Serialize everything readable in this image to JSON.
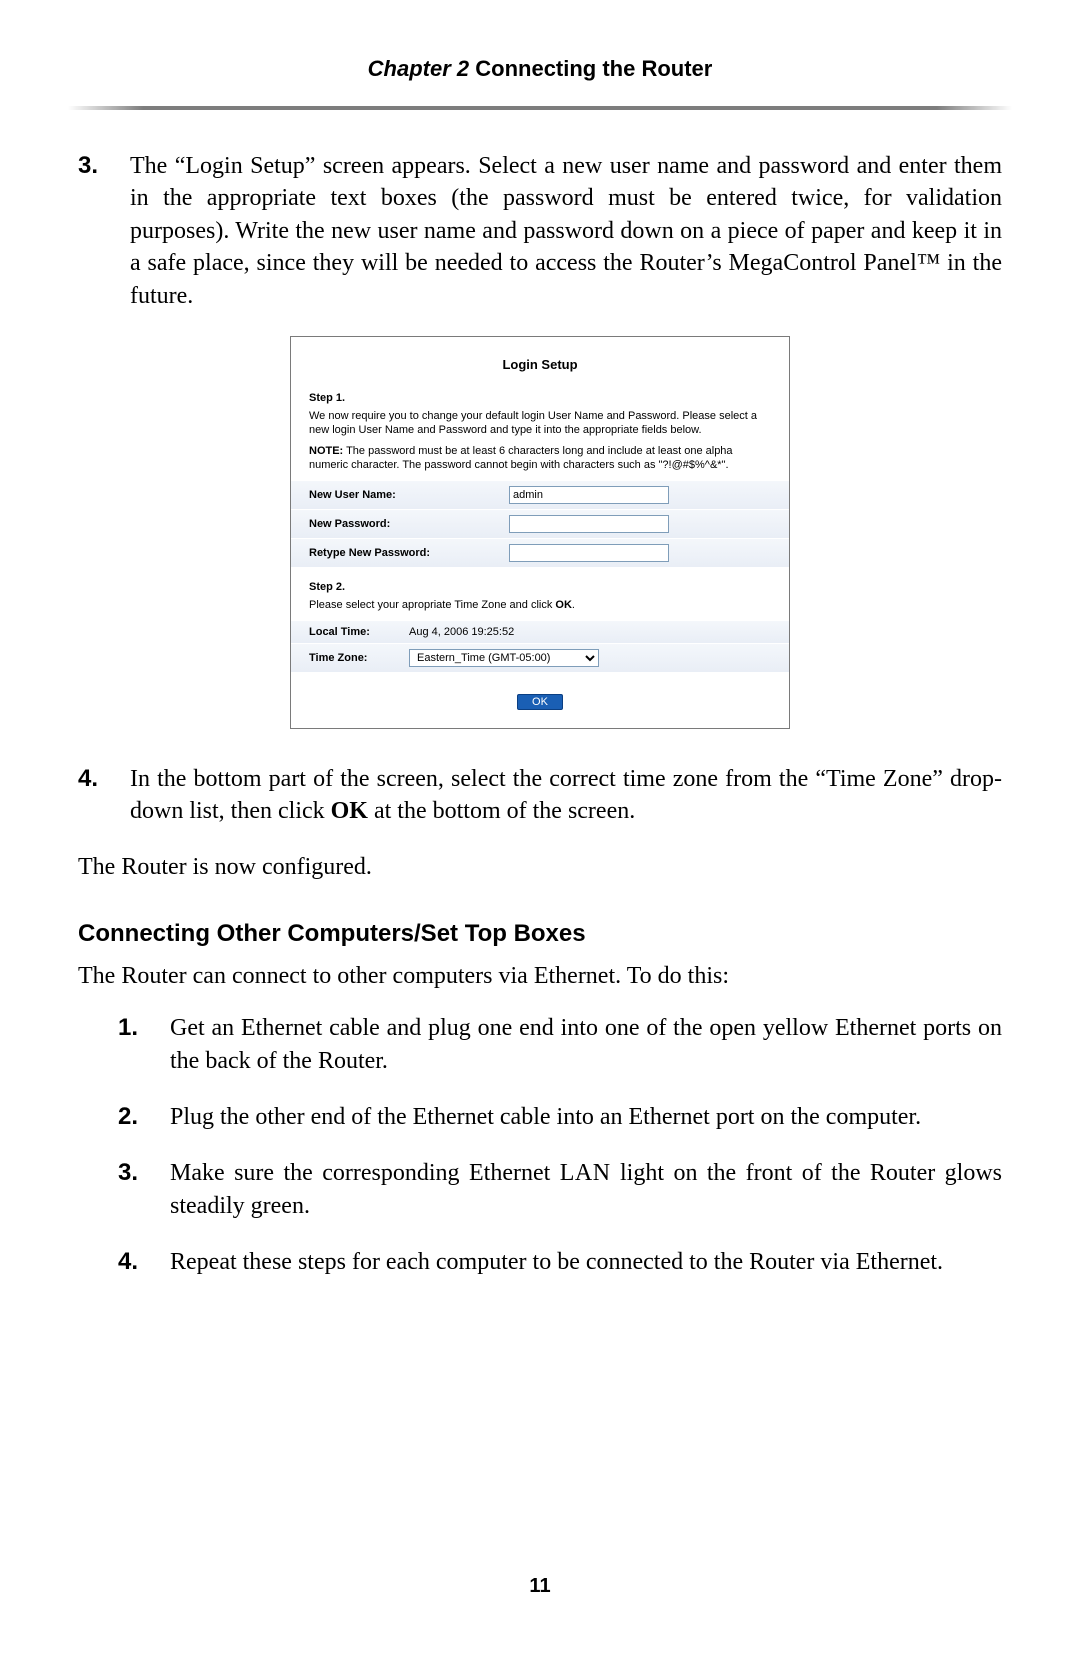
{
  "header": {
    "chapter_label": "Chapter 2",
    "chapter_title": "Connecting the Router"
  },
  "main": {
    "step3": {
      "num": "3.",
      "text_parts": {
        "a": "The “Login Setup” screen appears. Select a new user name and password and enter them in the appropriate text boxes (the password must be entered twice, for validation purposes). Write the new user name and password down on a piece of paper and keep it in a safe place, since they will be needed to access the Router’s MegaControl Panel™ in the future."
      }
    },
    "step4": {
      "num": "4.",
      "pre": "In the bottom part of the screen, select the correct time zone from the “Time Zone” drop-down list, then click ",
      "ok": "OK",
      "post": " at the bottom of the screen."
    },
    "config_done": "The Router is now configured.",
    "section_title": "Connecting Other Computers/Set Top Boxes",
    "section_intro": "The Router can connect to other computers via Ethernet. To do this:",
    "steps_b": [
      {
        "num": "1.",
        "text": "Get an Ethernet cable and plug one end into one of the open yellow Ethernet ports on the back of the Router."
      },
      {
        "num": "2.",
        "text": "Plug the other end of the Ethernet cable into an Ethernet port on the computer."
      },
      {
        "num": "3.",
        "pre": "Make sure the corresponding Ethernet ",
        "lan": "LAN",
        "post": " light on the front of the Router glows steadily green."
      },
      {
        "num": "4.",
        "text": "Repeat these steps for each computer to be connected to the Router via Ethernet."
      }
    ]
  },
  "panel": {
    "title": "Login Setup",
    "step1_label": "Step 1.",
    "step1_intro": "We now require you to change your default login User Name and Password. Please select a new login User Name and Password and type it into the appropriate fields below.",
    "note_label": "NOTE:",
    "note_body": " The password must be at least 6 characters long and include at least one alpha numeric character. The password cannot begin with characters such as \"?!@#$%^&*\".",
    "fields": {
      "new_user_label": "New User Name:",
      "new_user_value": "admin",
      "new_pw_label": "New Password:",
      "retype_pw_label": "Retype New Password:"
    },
    "step2_label": "Step 2.",
    "step2_intro_pre": "Please select your apropriate Time Zone and click ",
    "step2_intro_ok": "OK",
    "step2_intro_post": ".",
    "local_time_label": "Local Time:",
    "local_time_value": "Aug 4, 2006 19:25:52",
    "time_zone_label": "Time Zone:",
    "time_zone_value": "Eastern_Time (GMT-05:00)",
    "ok_button": "OK"
  },
  "page_number": "11"
}
